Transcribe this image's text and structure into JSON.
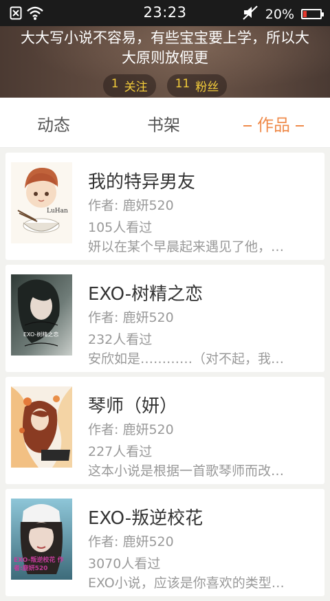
{
  "status_bar": {
    "time": "23:23",
    "battery": "20%",
    "battery_level": 0.2,
    "battery_color": "#e63a2e",
    "icons": [
      "sim-missing-icon",
      "wifi-icon",
      "mute-icon",
      "battery-icon"
    ]
  },
  "profile": {
    "signature": "大大写小说不容易，有些宝宝要上学，所以大大原则放假更",
    "following_count": "1",
    "following_label": "关注",
    "fans_count": "11",
    "fans_label": "粉丝"
  },
  "tabs": [
    {
      "label": "动态",
      "active": false
    },
    {
      "label": "书架",
      "active": false
    },
    {
      "label": "作品",
      "active": true
    }
  ],
  "accent_color": "#ef8a4a",
  "books": [
    {
      "title": "我的特异男友",
      "author": "作者: 鹿妍520",
      "views": "105人看过",
      "desc": "妍以在某个早晨起来遇见了他，…",
      "cover_text": "LuHan"
    },
    {
      "title": "EXO-树精之恋",
      "author": "作者: 鹿妍520",
      "views": "232人看过",
      "desc": "安欣如是…………（对不起，我…",
      "cover_text": "EXO-树精之恋"
    },
    {
      "title": "琴师（妍）",
      "author": "作者: 鹿妍520",
      "views": "227人看过",
      "desc": "这本小说是根据一首歌琴师而改…",
      "cover_text": ""
    },
    {
      "title": "EXO-叛逆校花",
      "author": "作者: 鹿妍520",
      "views": "3070人看过",
      "desc": "EXO小说，应该是你喜欢的类型…",
      "cover_text": "EXO-叛逆校花 作者:鹿妍520"
    }
  ]
}
